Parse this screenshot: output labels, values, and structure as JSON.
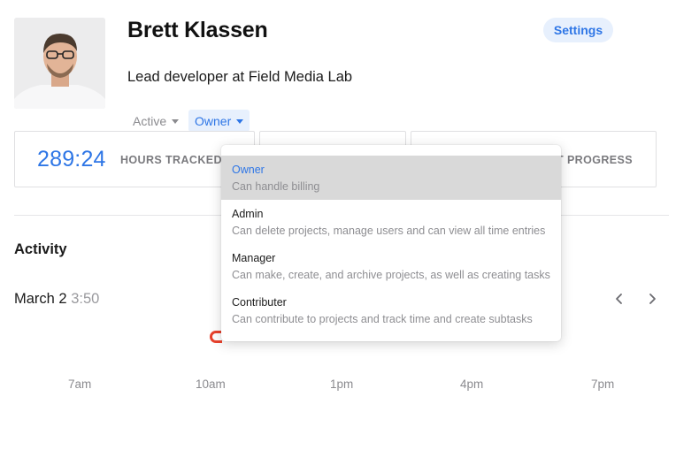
{
  "profile": {
    "name": "Brett Klassen",
    "subtitle": "Lead developer at Field Media Lab",
    "status_filter": "Active",
    "role_filter": "Owner"
  },
  "header": {
    "settings_label": "Settings"
  },
  "stats": {
    "hours_value": "289:24",
    "hours_label": "HOURS TRACKED",
    "progress_label_partial": "T PROGRESS"
  },
  "activity": {
    "title": "Activity",
    "date": "March 2",
    "date_total": "3:50"
  },
  "timeline": {
    "ticks": [
      "7am",
      "10am",
      "1pm",
      "4pm",
      "7pm"
    ]
  },
  "role_menu": {
    "options": [
      {
        "title": "Owner",
        "description": "Can handle billing",
        "selected": true
      },
      {
        "title": "Admin",
        "description": "Can delete projects, manage users and can view all time entries",
        "selected": false
      },
      {
        "title": "Manager",
        "description": "Can make, create, and archive projects, as well as creating tasks",
        "selected": false
      },
      {
        "title": "Contributer",
        "description": "Can contribute to projects and track time and create subtasks",
        "selected": false
      }
    ]
  },
  "colors": {
    "accent": "#2e76e6",
    "accent_bg": "#e7f0fd",
    "activity_bar": "#e8412c"
  },
  "icons": {
    "prev": "chevron-left-icon",
    "next": "chevron-right-icon",
    "caret": "caret-down-icon"
  }
}
